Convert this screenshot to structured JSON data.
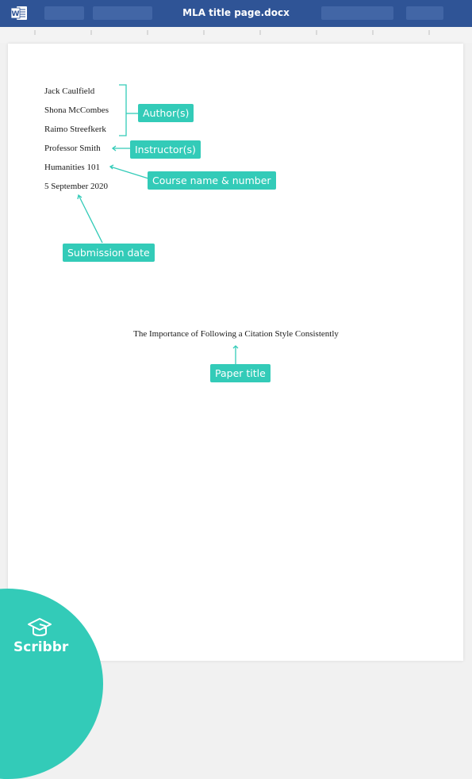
{
  "window": {
    "title": "MLA title page.docx",
    "app_icon": "word-icon"
  },
  "document": {
    "header_lines": [
      "Jack Caulfield",
      "Shona McCombes",
      "Raimo Streefkerk",
      "Professor Smith",
      "Humanities 101",
      "5 September 2020"
    ],
    "paper_title": "The Importance of Following a Citation Style Consistently"
  },
  "annotations": {
    "authors": "Author(s)",
    "instructor": "Instructor(s)",
    "course": "Course name & number",
    "date": "Submission date",
    "title": "Paper title"
  },
  "colors": {
    "accent": "#33cbb8",
    "titlebar": "#2f5496"
  },
  "branding": {
    "logo_text": "Scribbr",
    "logo_icon": "graduation-cap-icon"
  }
}
